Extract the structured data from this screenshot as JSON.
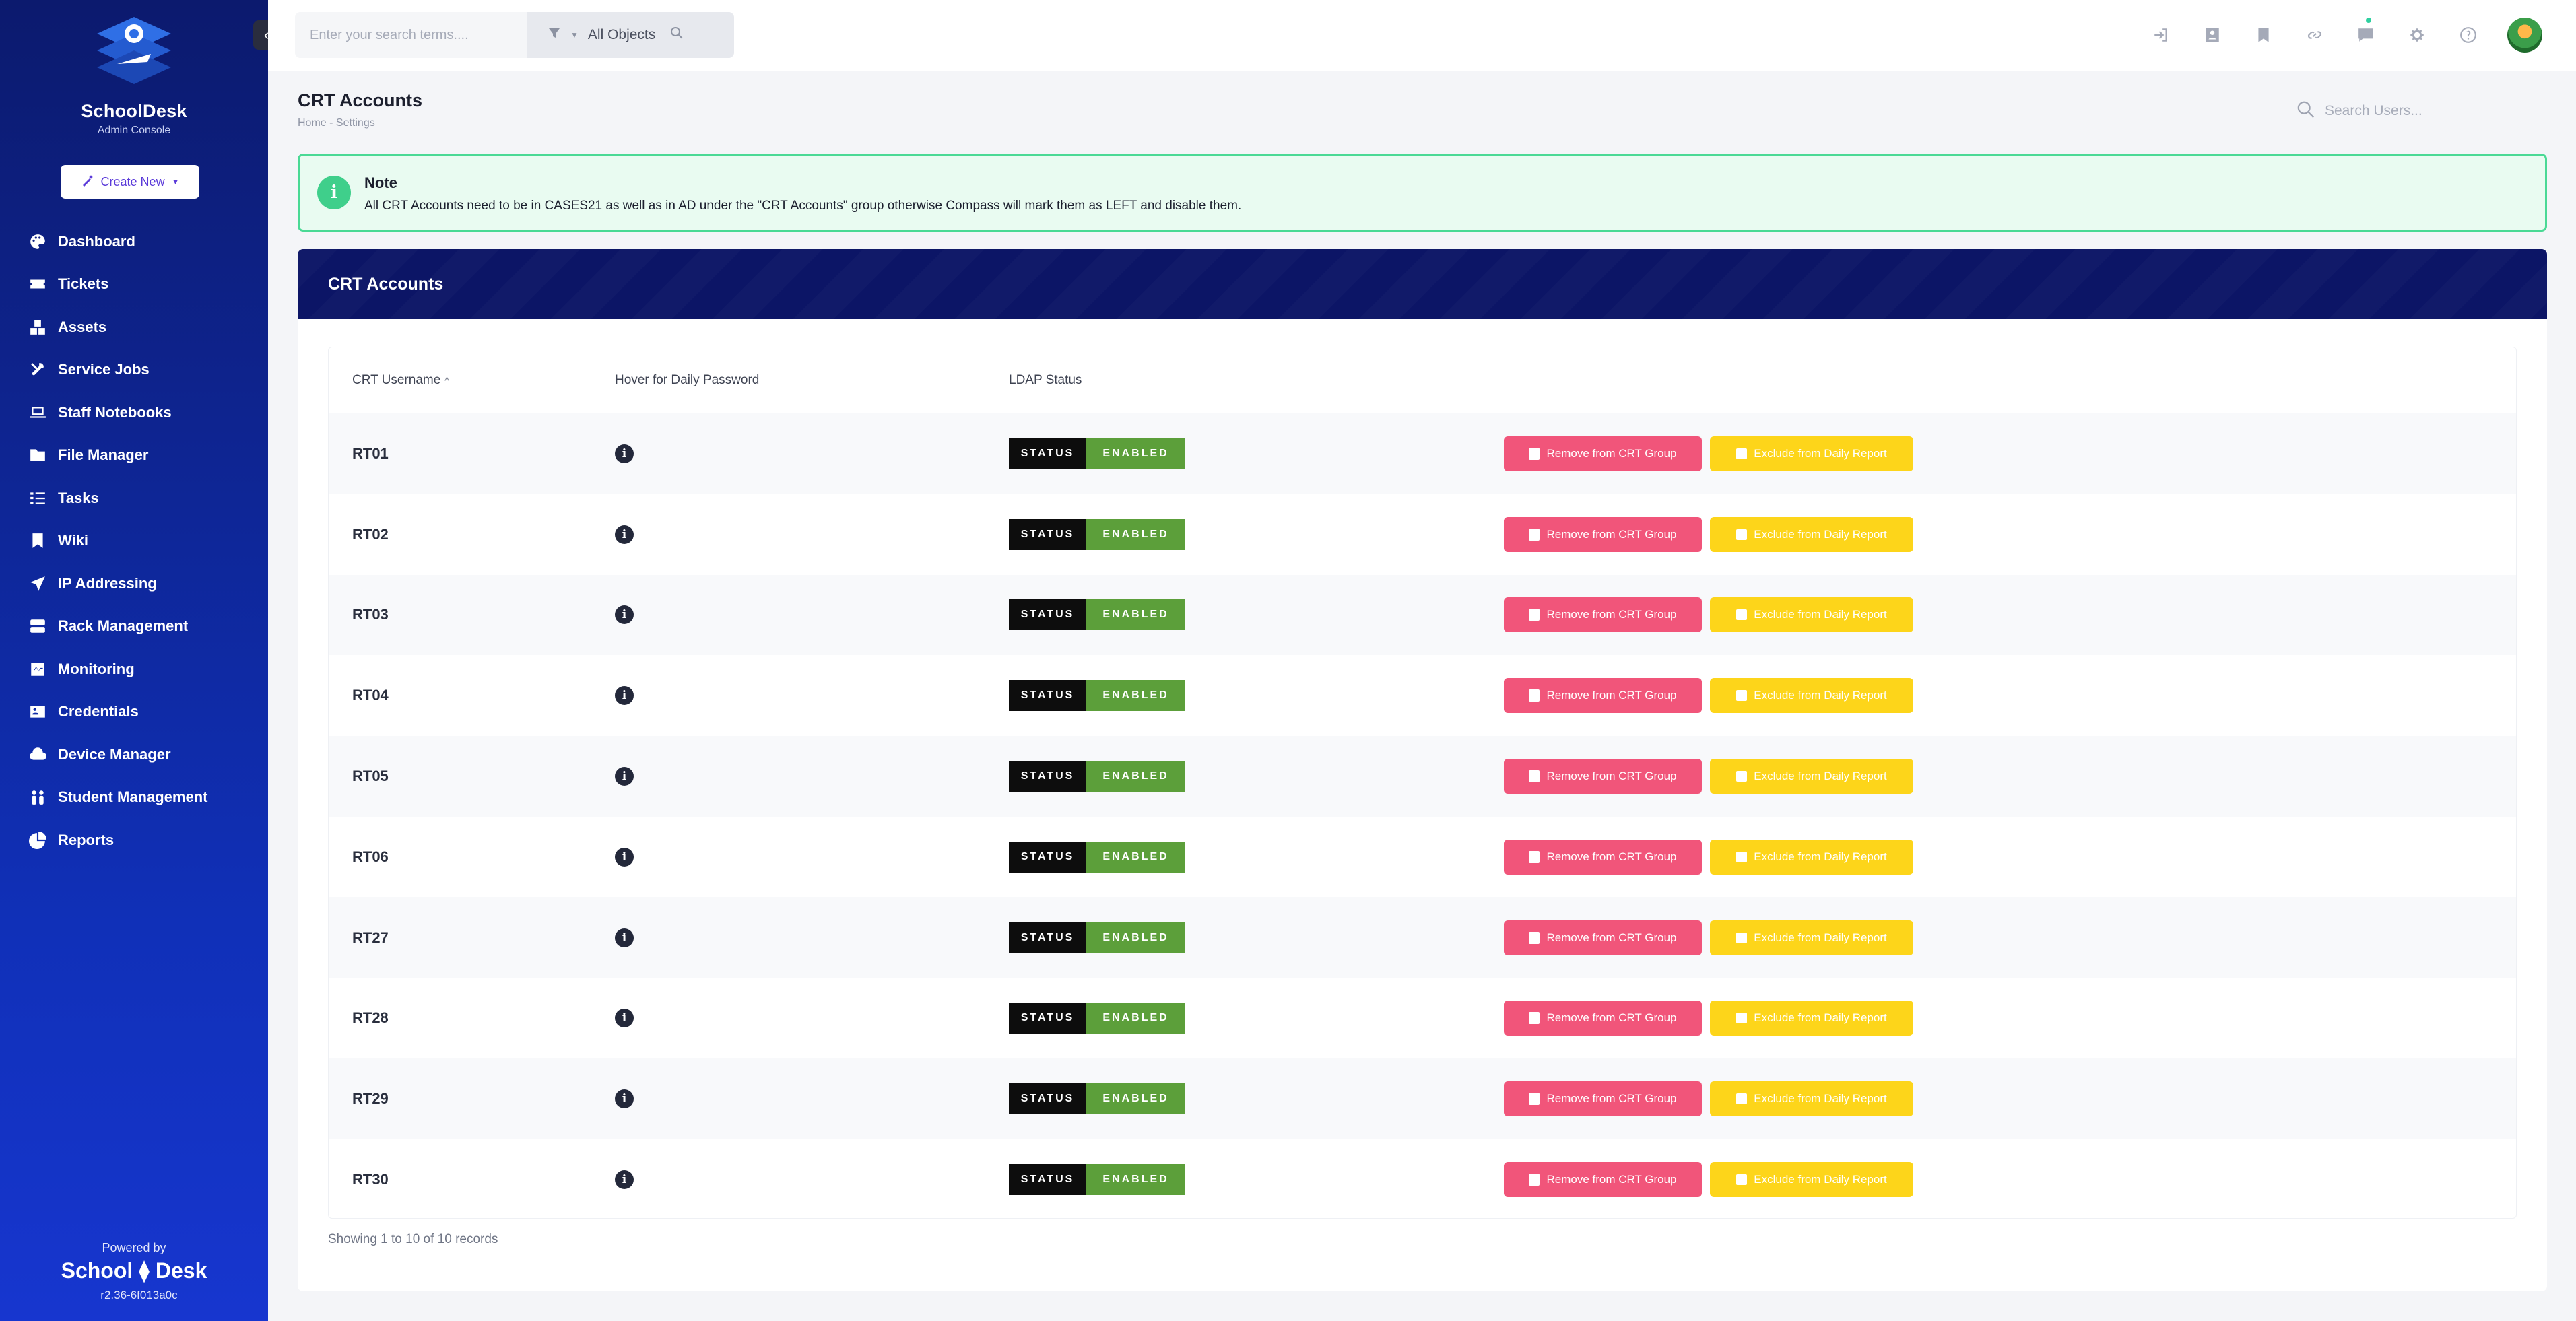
{
  "sidebar": {
    "brand_name": "SchoolDesk",
    "brand_sub": "Admin Console",
    "create_label": "Create New",
    "items": [
      {
        "label": "Dashboard",
        "icon": "palette-icon"
      },
      {
        "label": "Tickets",
        "icon": "ticket-icon"
      },
      {
        "label": "Assets",
        "icon": "boxes-icon"
      },
      {
        "label": "Service Jobs",
        "icon": "tools-icon"
      },
      {
        "label": "Staff Notebooks",
        "icon": "laptop-icon"
      },
      {
        "label": "File Manager",
        "icon": "folder-icon"
      },
      {
        "label": "Tasks",
        "icon": "tasks-icon"
      },
      {
        "label": "Wiki",
        "icon": "bookmark-icon"
      },
      {
        "label": "IP Addressing",
        "icon": "send-icon"
      },
      {
        "label": "Rack Management",
        "icon": "server-icon"
      },
      {
        "label": "Monitoring",
        "icon": "pulse-icon"
      },
      {
        "label": "Credentials",
        "icon": "id-card-icon"
      },
      {
        "label": "Device Manager",
        "icon": "cloud-icon"
      },
      {
        "label": "Student Management",
        "icon": "users-icon"
      },
      {
        "label": "Reports",
        "icon": "pie-chart-icon"
      }
    ],
    "powered_by": "Powered by",
    "powered_brand": "School ⧫ Desk",
    "version": "r2.36-6f013a0c"
  },
  "topbar": {
    "search_placeholder": "Enter your search terms....",
    "filter_label": "All Objects"
  },
  "page": {
    "title": "CRT Accounts",
    "breadcrumb": "Home  -  Settings",
    "user_search_placeholder": "Search Users..."
  },
  "note": {
    "title": "Note",
    "body": "All CRT Accounts need to be in CASES21 as well as in AD under the \"CRT Accounts\" group otherwise Compass will mark them as LEFT and disable them."
  },
  "card": {
    "title": "CRT Accounts",
    "columns": [
      "CRT Username",
      "Hover for Daily Password",
      "LDAP Status"
    ],
    "status_label": "STATUS",
    "status_value": "ENABLED",
    "remove_label": "Remove from CRT Group",
    "exclude_label": "Exclude from Daily Report",
    "rows": [
      "RT01",
      "RT02",
      "RT03",
      "RT04",
      "RT05",
      "RT06",
      "RT27",
      "RT28",
      "RT29",
      "RT30"
    ],
    "records_text": "Showing 1 to 10 of 10 records"
  },
  "colors": {
    "sidebar_top": "#0c1a6e",
    "sidebar_bottom": "#1736cf",
    "card_header": "#0c1566",
    "status_enabled": "#5c9f3a",
    "remove": "#f1557a",
    "exclude": "#fdd51a",
    "note_border": "#4ad995"
  }
}
